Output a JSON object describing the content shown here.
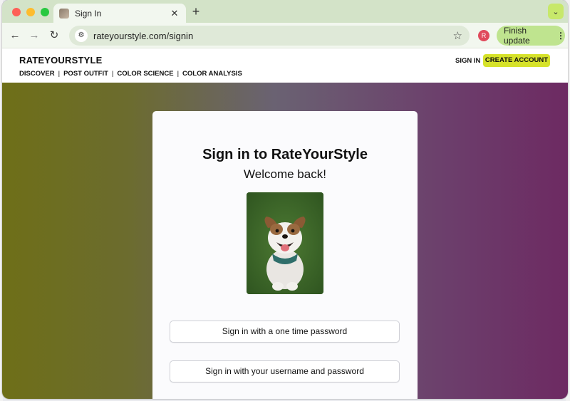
{
  "browser": {
    "tab_title": "Sign In",
    "new_tab_symbol": "+",
    "url": "rateyourstyle.com/signin",
    "profile_initial": "R",
    "update_label": "Finish update"
  },
  "site": {
    "logo": "RATEYOURSTYLE",
    "nav": [
      "DISCOVER",
      "POST OUTFIT",
      "COLOR SCIENCE",
      "COLOR ANALYSIS"
    ],
    "sign_in_label": "SIGN IN",
    "create_account_label": "CREATE ACCOUNT"
  },
  "card": {
    "title": "Sign in to RateYourStyle",
    "subtitle": "Welcome back!",
    "otp_button": "Sign in with a one time password",
    "password_button": "Sign in with your username and password"
  },
  "colors": {
    "accent": "#d6e22a",
    "tab_strip": "#d3e3c8"
  }
}
